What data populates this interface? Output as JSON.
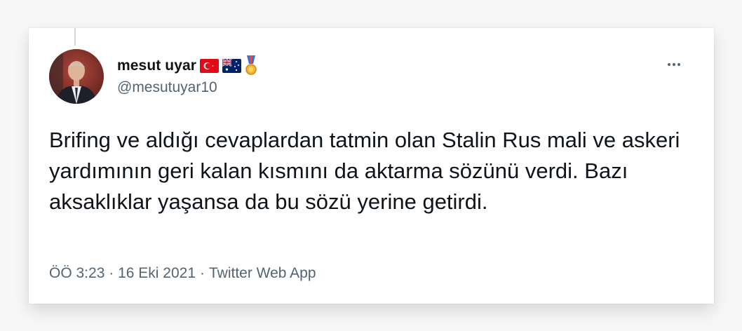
{
  "tweet": {
    "author": {
      "display_name": "mesut uyar",
      "handle": "@mesutuyar10",
      "badges": [
        "turkey-flag-icon",
        "australia-flag-icon",
        "medal-icon"
      ]
    },
    "text": "Brifing ve aldığı cevaplardan tatmin olan Stalin Rus mali ve askeri yardımının geri kalan kısmını da aktarma sözünü verdi. Bazı aksaklıklar yaşansa da bu sözü yerine getirdi.",
    "meta": {
      "time": "ÖÖ 3:23",
      "separator": "·",
      "date": "16 Eki 2021",
      "source": "Twitter Web App"
    },
    "more_icon": "more-options-icon"
  },
  "colors": {
    "text_primary": "#0f1419",
    "text_secondary": "#536471",
    "card_background": "#ffffff",
    "page_background": "#f7f7f7"
  }
}
